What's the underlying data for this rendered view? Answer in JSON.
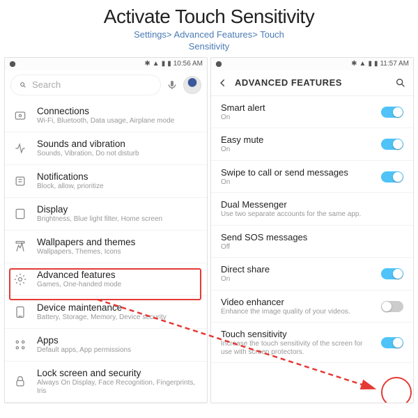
{
  "header": {
    "title": "Activate Touch Sensitivity",
    "breadcrumb1": "Settings> Advanced Features> Touch",
    "breadcrumb2": "Sensitivity"
  },
  "left": {
    "status_time": "10:56 AM",
    "search_placeholder": "Search",
    "rows": [
      {
        "title": "Connections",
        "desc": "Wi-Fi, Bluetooth, Data usage, Airplane mode"
      },
      {
        "title": "Sounds and vibration",
        "desc": "Sounds, Vibration, Do not disturb"
      },
      {
        "title": "Notifications",
        "desc": "Block, allow, prioritize"
      },
      {
        "title": "Display",
        "desc": "Brightness, Blue light filter, Home screen"
      },
      {
        "title": "Wallpapers and themes",
        "desc": "Wallpapers, Themes, Icons"
      },
      {
        "title": "Advanced features",
        "desc": "Games, One-handed mode"
      },
      {
        "title": "Device maintenance",
        "desc": "Battery, Storage, Memory, Device security"
      },
      {
        "title": "Apps",
        "desc": "Default apps, App permissions"
      },
      {
        "title": "Lock screen and security",
        "desc": "Always On Display, Face Recognition, Fingerprints, Iris"
      }
    ]
  },
  "right": {
    "status_time": "11:57 AM",
    "header_title": "ADVANCED FEATURES",
    "rows": [
      {
        "title": "Smart alert",
        "desc": "On",
        "toggle": "on"
      },
      {
        "title": "Easy mute",
        "desc": "On",
        "toggle": "on"
      },
      {
        "title": "Swipe to call or send messages",
        "desc": "On",
        "toggle": "on"
      },
      {
        "title": "Dual Messenger",
        "desc": "Use two separate accounts for the same app.",
        "toggle": ""
      },
      {
        "title": "Send SOS messages",
        "desc": "Off",
        "toggle": ""
      },
      {
        "title": "Direct share",
        "desc": "On",
        "toggle": "on"
      },
      {
        "title": "Video enhancer",
        "desc": "Enhance the image quality of your videos.",
        "toggle": "off"
      },
      {
        "title": "Touch sensitivity",
        "desc": "Increase the touch sensitivity of the screen for use with screen protectors.",
        "toggle": "on"
      }
    ]
  }
}
